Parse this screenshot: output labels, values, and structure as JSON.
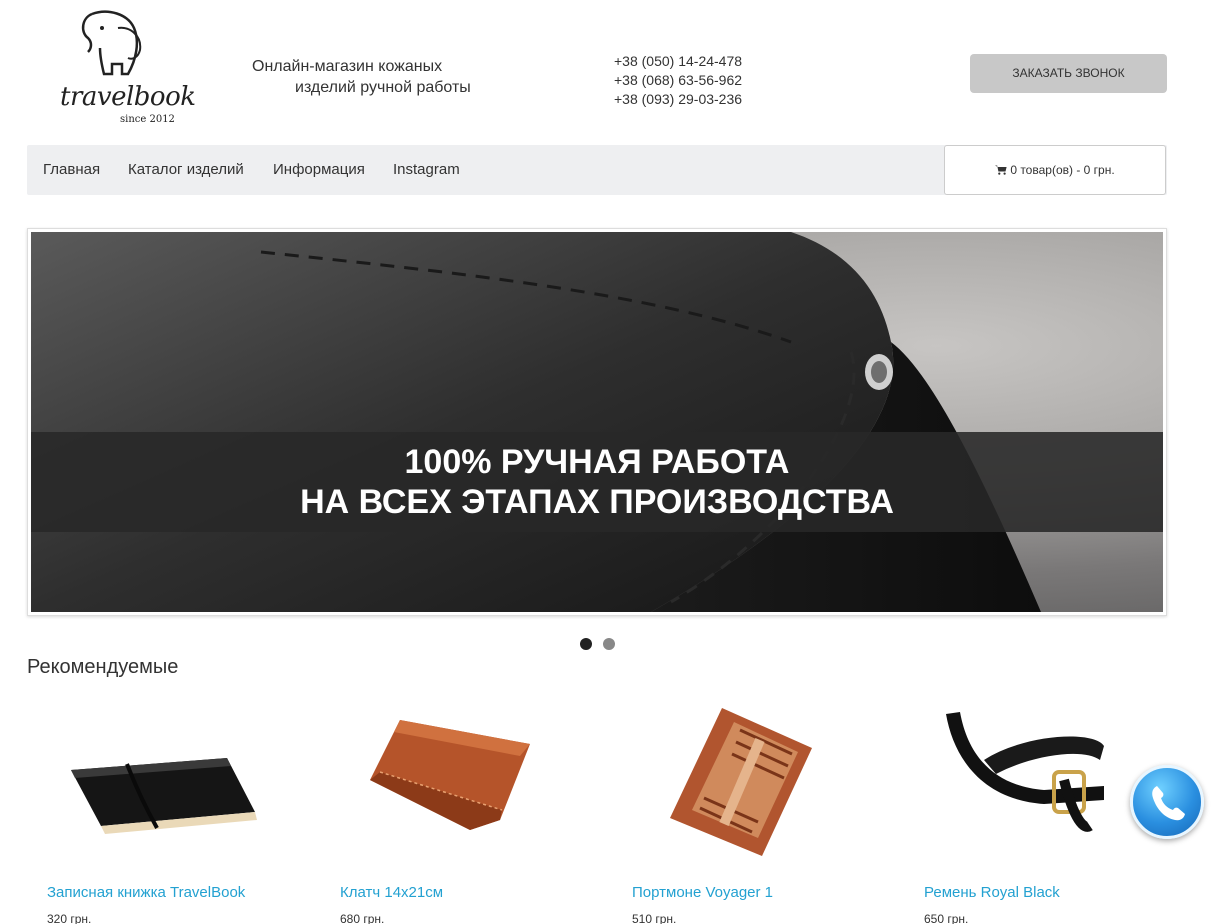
{
  "logo": {
    "wordmark": "travelbook",
    "since": "since 2012"
  },
  "header": {
    "tagline_line1": "Онлайн-магазин кожаных",
    "tagline_line2": "изделий ручной работы",
    "phones": [
      "+38 (050) 14-24-478",
      "+38 (068) 63-56-962",
      "+38 (093) 29-03-236"
    ],
    "callback_label": "ЗАКАЗАТЬ ЗВОНОК"
  },
  "nav": {
    "items": [
      {
        "label": "Главная"
      },
      {
        "label": "Каталог изделий"
      },
      {
        "label": "Информация"
      },
      {
        "label": "Instagram"
      }
    ],
    "cart_label": "0 товар(ов) - 0 грн.",
    "cart_icon": "shopping-cart-icon"
  },
  "banner": {
    "line1": "100% РУЧНАЯ РАБОТА",
    "line2": "НА ВСЕХ ЭТАПАХ ПРОИЗВОДСТВА",
    "slide_count": 2,
    "active_slide": 1
  },
  "featured": {
    "title": "Рекомендуемые",
    "products": [
      {
        "name": "Записная книжка TravelBook",
        "price": "320 грн."
      },
      {
        "name": "Клатч 14x21см",
        "price": "680 грн."
      },
      {
        "name": "Портмоне Voyager 1",
        "price": "510 грн."
      },
      {
        "name": "Ремень Royal Black",
        "price": "650 грн."
      }
    ]
  },
  "colors": {
    "link": "#23a1d1",
    "navbar_bg": "#eeeff1",
    "callback_bg": "#c8c8c8",
    "fab": "#2a8fe0"
  },
  "fab_icon": "phone-icon"
}
